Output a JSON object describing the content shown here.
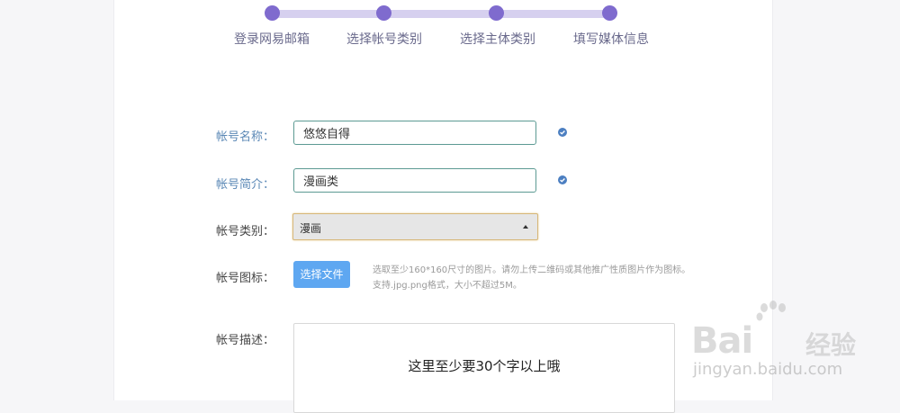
{
  "steps": [
    {
      "label": "登录网易邮箱"
    },
    {
      "label": "选择帐号类别"
    },
    {
      "label": "选择主体类别"
    },
    {
      "label": "填写媒体信息"
    }
  ],
  "form": {
    "name": {
      "label": "帐号名称：",
      "value": "悠悠自得"
    },
    "intro": {
      "label": "帐号简介：",
      "value": "漫画类"
    },
    "category": {
      "label": "帐号类别：",
      "value": "漫画"
    },
    "icon": {
      "label": "帐号图标：",
      "button": "选择文件",
      "hint_line1": "选取至少160*160尺寸的图片。请勿上传二维码或其他推广性质图片作为图标。",
      "hint_line2": "支持.jpg.png格式，大小不超过5M。"
    },
    "description": {
      "label": "帐号描述：",
      "value": "这里至少要30个字以上哦"
    }
  },
  "watermark": {
    "brand": "Bai",
    "brand_suffix": "经验",
    "url": "jingyan.baidu.com"
  },
  "colors": {
    "accent": "#7f6bce",
    "step_track": "#d6d0ef",
    "button": "#5ea7f1",
    "check": "#4c7fc1"
  }
}
